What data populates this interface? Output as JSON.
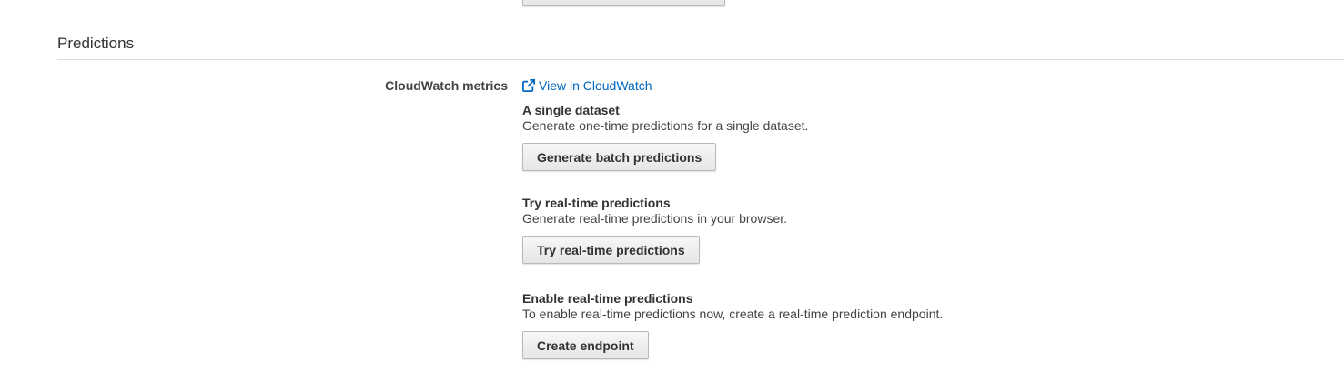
{
  "section": {
    "title": "Predictions"
  },
  "cloudwatch": {
    "label": "CloudWatch metrics",
    "link_text": "View in CloudWatch",
    "link_icon": "external-link-icon"
  },
  "blocks": [
    {
      "title": "A single dataset",
      "description": "Generate one-time predictions for a single dataset.",
      "button_label": "Generate batch predictions"
    },
    {
      "title": "Try real-time predictions",
      "description": "Generate real-time predictions in your browser.",
      "button_label": "Try real-time predictions"
    },
    {
      "title": "Enable real-time predictions",
      "description": "To enable real-time predictions now, create a real-time prediction endpoint.",
      "button_label": "Create endpoint"
    }
  ],
  "colors": {
    "link": "#0066c0",
    "divider": "#dddddd",
    "button_border": "#b9b9b9"
  }
}
